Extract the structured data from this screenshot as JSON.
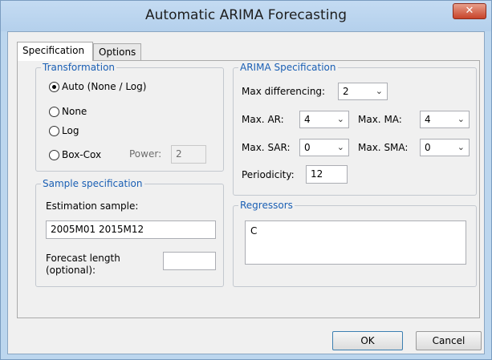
{
  "window": {
    "title": "Automatic ARIMA Forecasting",
    "close_label": "✕"
  },
  "tabs": [
    {
      "label": "Specification",
      "active": true
    },
    {
      "label": "Options",
      "active": false
    }
  ],
  "transformation": {
    "title": "Transformation",
    "options": [
      {
        "label": "Auto (None / Log)",
        "checked": true
      },
      {
        "label": "None",
        "checked": false
      },
      {
        "label": "Log",
        "checked": false
      },
      {
        "label": "Box-Cox",
        "checked": false
      }
    ],
    "power_label": "Power:",
    "power_value": "2"
  },
  "sample": {
    "title": "Sample specification",
    "estimation_label": "Estimation sample:",
    "estimation_value": "2005M01 2015M12",
    "forecast_label_line1": "Forecast length",
    "forecast_label_line2": "(optional):",
    "forecast_value": ""
  },
  "arima": {
    "title": "ARIMA Specification",
    "max_diff_label": "Max differencing:",
    "max_diff_value": "2",
    "max_ar_label": "Max. AR:",
    "max_ar_value": "4",
    "max_ma_label": "Max. MA:",
    "max_ma_value": "4",
    "max_sar_label": "Max. SAR:",
    "max_sar_value": "0",
    "max_sma_label": "Max. SMA:",
    "max_sma_value": "0",
    "periodicity_label": "Periodicity:",
    "periodicity_value": "12"
  },
  "regressors": {
    "title": "Regressors",
    "value": "C"
  },
  "buttons": {
    "ok": "OK",
    "cancel": "Cancel"
  },
  "icons": {
    "dropdown": "⌄"
  }
}
